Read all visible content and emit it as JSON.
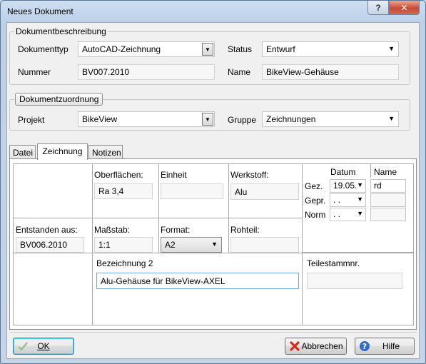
{
  "window": {
    "title": "Neues Dokument",
    "help_glyph": "?",
    "close_glyph": "✕"
  },
  "beschreibung": {
    "legend": "Dokumentbeschreibung",
    "dokumenttyp_label": "Dokumenttyp",
    "dokumenttyp_value": "AutoCAD-Zeichnung",
    "status_label": "Status",
    "status_value": "Entwurf",
    "nummer_label": "Nummer",
    "nummer_value": "BV007.2010",
    "name_label": "Name",
    "name_value": "BikeView-Gehäuse"
  },
  "zuordnung": {
    "legend": "Dokumentzuordnung",
    "projekt_label": "Projekt",
    "projekt_value": "BikeView",
    "gruppe_label": "Gruppe",
    "gruppe_value": "Zeichnungen"
  },
  "tabs": [
    {
      "label": "Datei"
    },
    {
      "label": "Zeichnung"
    },
    {
      "label": "Notizen"
    }
  ],
  "zeichnung": {
    "oberflaechen_label": "Oberflächen:",
    "oberflaechen_value": "Ra 3,4",
    "einheit_label": "Einheit",
    "einheit_value": "",
    "werkstoff_label": "Werkstoff:",
    "werkstoff_value": "Alu",
    "datum_header": "Datum",
    "name_header": "Name",
    "rows": [
      {
        "label": "Gez.",
        "datum": "19.05.",
        "name": "rd"
      },
      {
        "label": "Gepr.",
        "datum": ". .",
        "name": ""
      },
      {
        "label": "Norm",
        "datum": ". .",
        "name": ""
      }
    ],
    "entstanden_label": "Entstanden aus:",
    "entstanden_value": "BV006.2010",
    "massstab_label": "Maßstab:",
    "massstab_value": "1:1",
    "format_label": "Format:",
    "format_value": "A2",
    "rohteil_label": "Rohteil:",
    "rohteil_value": "",
    "bezeichnung2_label": "Bezeichnung 2",
    "bezeichnung2_value": "Alu-Gehäuse für BikeView-AXEL",
    "teilestamm_label": "Teilestammnr.",
    "teilestamm_value": ""
  },
  "buttons": {
    "ok": "OK",
    "abbrechen": "Abbrechen",
    "hilfe": "Hilfe"
  }
}
